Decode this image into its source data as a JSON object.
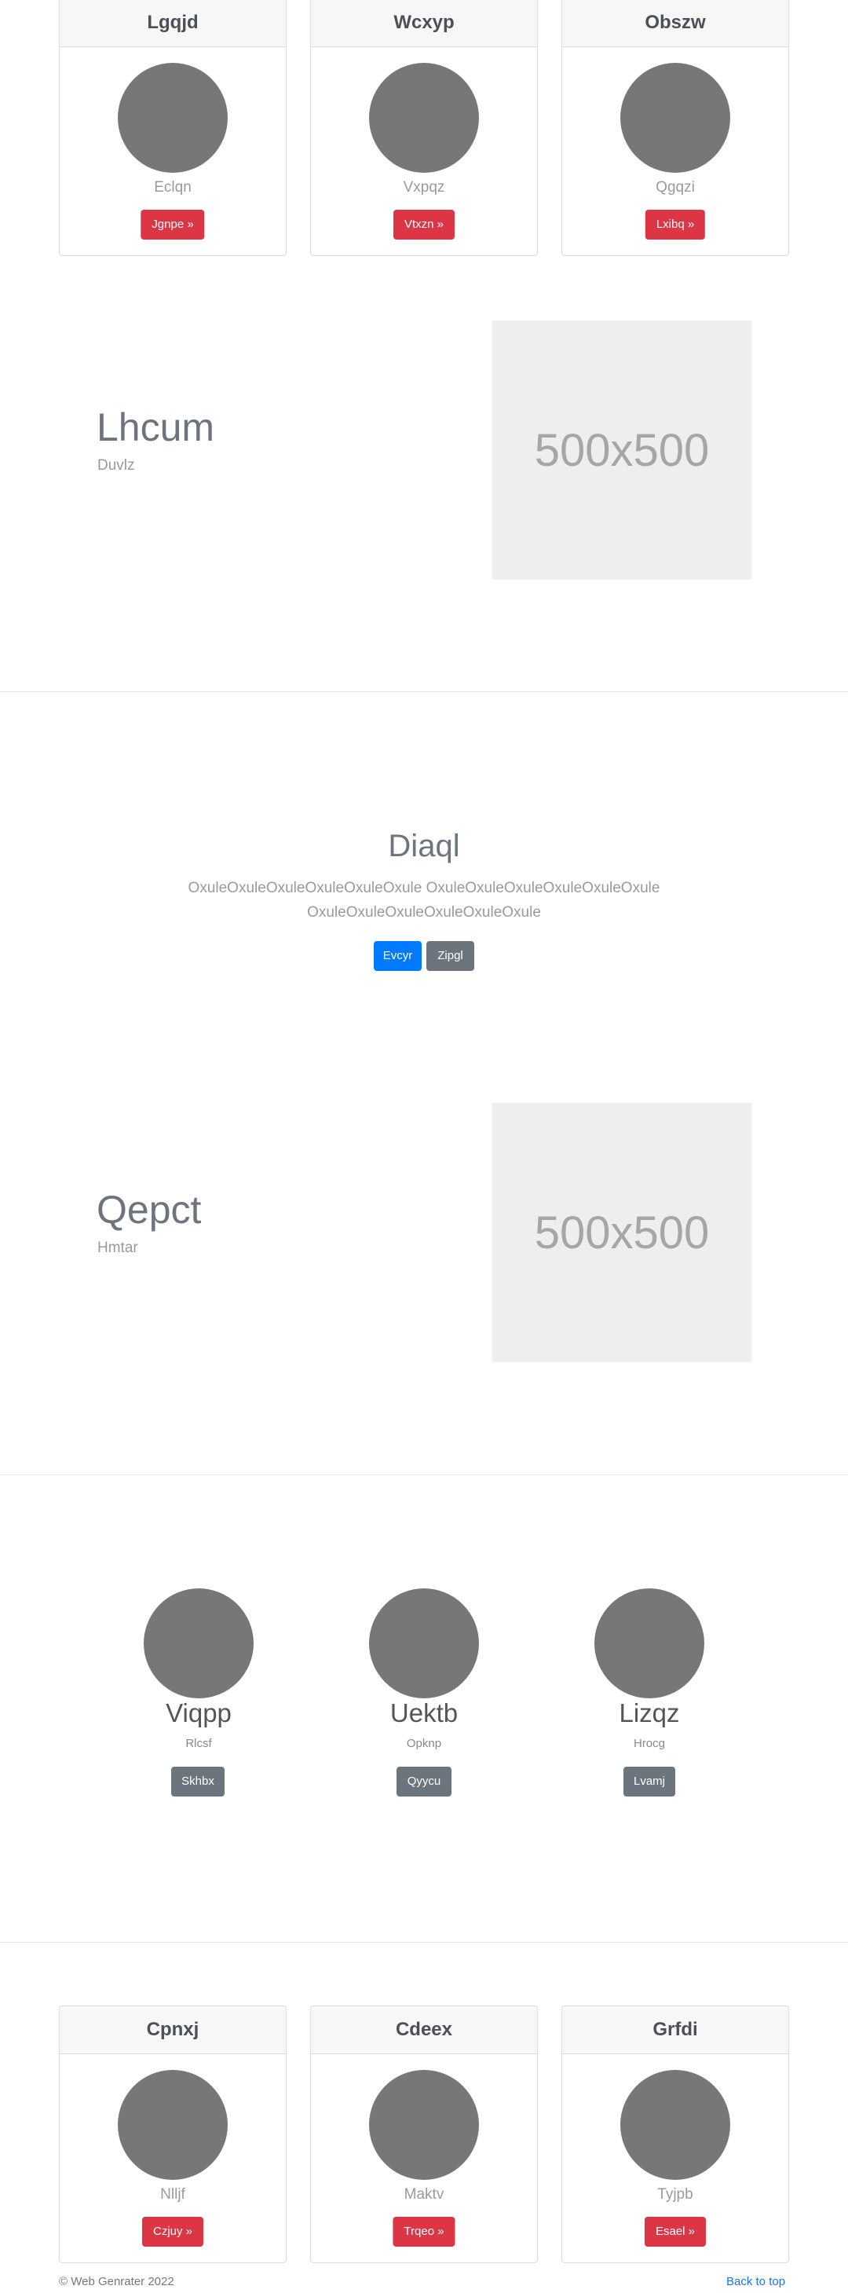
{
  "top_cards": [
    {
      "title": "Lgqjd",
      "subtitle": "Eclqn",
      "button": "Jgnpe »"
    },
    {
      "title": "Wcxyp",
      "subtitle": "Vxpqz",
      "button": "Vtxzn »"
    },
    {
      "title": "Obszw",
      "subtitle": "Qgqzi",
      "button": "Lxibq »"
    }
  ],
  "feature1": {
    "title": "Lhcum",
    "subtitle": "Duvlz",
    "image_label": "500x500"
  },
  "center": {
    "title": "Diaql",
    "text": "OxuleOxuleOxuleOxuleOxuleOxule OxuleOxuleOxuleOxuleOxuleOxule OxuleOxuleOxuleOxuleOxuleOxule",
    "primary_button": "Evcyr",
    "secondary_button": "Zipgl"
  },
  "feature2": {
    "title": "Qepct",
    "subtitle": "Hmtar",
    "image_label": "500x500"
  },
  "team": [
    {
      "name": "Viqpp",
      "role": "Rlcsf",
      "button": "Skhbx"
    },
    {
      "name": "Uektb",
      "role": "Opknp",
      "button": "Qyycu"
    },
    {
      "name": "Lizqz",
      "role": "Hrocg",
      "button": "Lvamj"
    }
  ],
  "bottom_cards": [
    {
      "title": "Cpnxj",
      "subtitle": "Nlljf",
      "button": "Czjuy »"
    },
    {
      "title": "Cdeex",
      "subtitle": "Maktv",
      "button": "Trqeo »"
    },
    {
      "title": "Grfdi",
      "subtitle": "Tyjpb",
      "button": "Esael »"
    }
  ],
  "footer": {
    "copyright": "© Web Genrater 2022",
    "back_to_top": "Back to top"
  },
  "colors": {
    "danger": "#dc3545",
    "primary": "#007bff",
    "secondary": "#6c757d",
    "link": "#1a73e8"
  }
}
